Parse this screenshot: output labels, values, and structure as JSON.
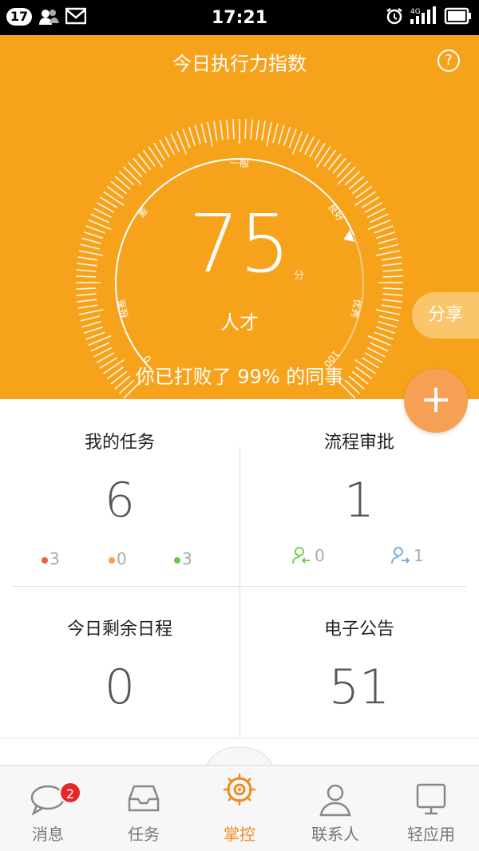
{
  "status_bar": {
    "badge": "17",
    "time": "17:21",
    "network": "4G"
  },
  "header": {
    "title": "今日执行力指数",
    "help": "?",
    "gauge_labels": {
      "worst": "极差",
      "poor": "差",
      "normal": "一般",
      "good": "良好",
      "excellent": "优秀",
      "min": "0",
      "max": "100"
    },
    "score": "75",
    "score_unit": "分",
    "rank": "人才",
    "beat_text": "你已打败了 99% 的同事",
    "share_label": "分享",
    "add_label": "+"
  },
  "grid": {
    "tasks": {
      "title": "我的任务",
      "value": "6",
      "stats": [
        {
          "value": "3",
          "color": "#f25a3c"
        },
        {
          "value": "0",
          "color": "#f6a054"
        },
        {
          "value": "3",
          "color": "#6cc644"
        }
      ]
    },
    "approval": {
      "title": "流程审批",
      "value": "1",
      "stats": [
        {
          "value": "0",
          "icon": "user-arrow-in-icon",
          "color": "#6cc644"
        },
        {
          "value": "1",
          "icon": "user-arrow-out-icon",
          "color": "#6aa4e6"
        }
      ]
    },
    "schedule": {
      "title": "今日剩余日程",
      "value": "0"
    },
    "notice": {
      "title": "电子公告",
      "value": "51"
    }
  },
  "tabbar": {
    "items": [
      {
        "label": "消息",
        "icon": "chat-bubble-icon",
        "badge": "2"
      },
      {
        "label": "任务",
        "icon": "inbox-tray-icon"
      },
      {
        "label": "掌控",
        "icon": "target-wheel-icon",
        "active": true
      },
      {
        "label": "联系人",
        "icon": "person-icon"
      },
      {
        "label": "轻应用",
        "icon": "monitor-icon"
      }
    ]
  }
}
